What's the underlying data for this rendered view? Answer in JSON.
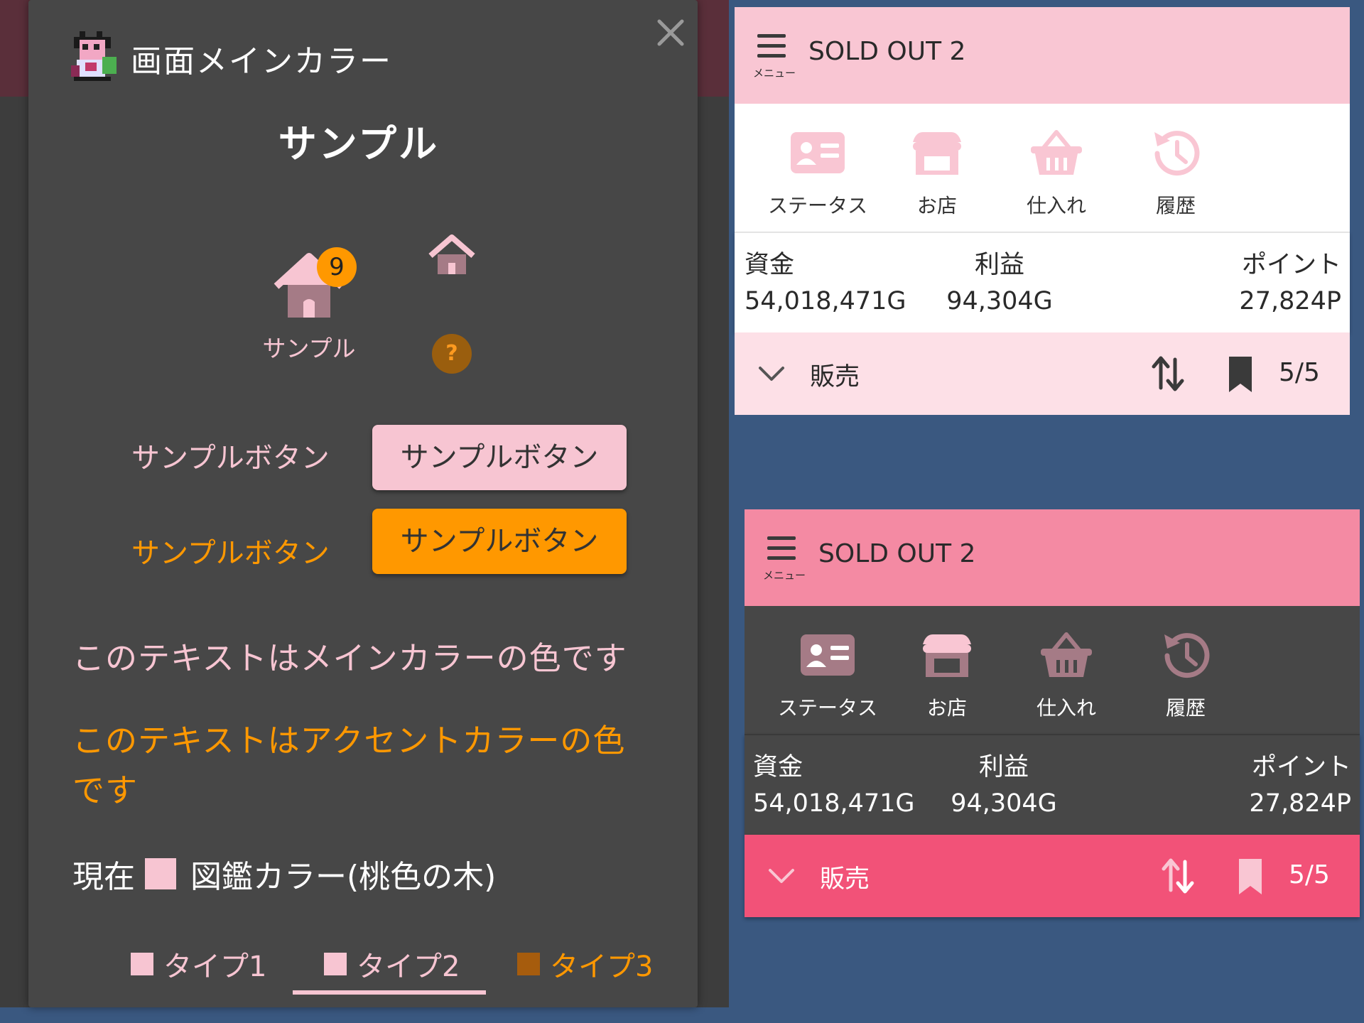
{
  "colors": {
    "main": "#f7c5d2",
    "accent": "#ff9800",
    "dialog_bg": "#474747",
    "type3": "#a65c0d",
    "preview_bg": "#3a5880"
  },
  "dialog": {
    "title": "画面メインカラー",
    "heading": "サンプル",
    "home_badge": "9",
    "home_label": "サンプル",
    "help_icon": "?",
    "text_button_main": "サンプルボタン",
    "text_button_accent": "サンプルボタン",
    "filled_button_main": "サンプルボタン",
    "filled_button_accent": "サンプルボタン",
    "main_color_text": "このテキストはメインカラーの色です",
    "accent_color_text": "このテキストはアクセントカラーの色です",
    "current_label": "現在",
    "current_value": "図鑑カラー(桃色の木)",
    "tabs": [
      {
        "label": "タイプ1",
        "color": "#f7c5d2",
        "selected": false
      },
      {
        "label": "タイプ2",
        "color": "#f7c5d2",
        "selected": true
      },
      {
        "label": "タイプ3",
        "color": "#a65c0d",
        "selected": false
      }
    ]
  },
  "previews": [
    {
      "theme": "light",
      "menu_label": "メニュー",
      "title": "SOLD OUT 2",
      "nav": [
        {
          "label": "ステータス",
          "icon": "id-card-icon"
        },
        {
          "label": "お店",
          "icon": "store-icon"
        },
        {
          "label": "仕入れ",
          "icon": "basket-icon"
        },
        {
          "label": "履歴",
          "icon": "history-icon"
        }
      ],
      "stats": [
        {
          "label": "資金",
          "value": "54,018,471G"
        },
        {
          "label": "利益",
          "value": "94,304G"
        },
        {
          "label": "ポイント",
          "value": "27,824P"
        }
      ],
      "sale_label": "販売",
      "sale_count": "5/5"
    },
    {
      "theme": "dark",
      "menu_label": "メニュー",
      "title": "SOLD OUT 2",
      "nav": [
        {
          "label": "ステータス",
          "icon": "id-card-icon"
        },
        {
          "label": "お店",
          "icon": "store-icon"
        },
        {
          "label": "仕入れ",
          "icon": "basket-icon"
        },
        {
          "label": "履歴",
          "icon": "history-icon"
        }
      ],
      "stats": [
        {
          "label": "資金",
          "value": "54,018,471G"
        },
        {
          "label": "利益",
          "value": "94,304G"
        },
        {
          "label": "ポイント",
          "value": "27,824P"
        }
      ],
      "sale_label": "販売",
      "sale_count": "5/5"
    }
  ]
}
